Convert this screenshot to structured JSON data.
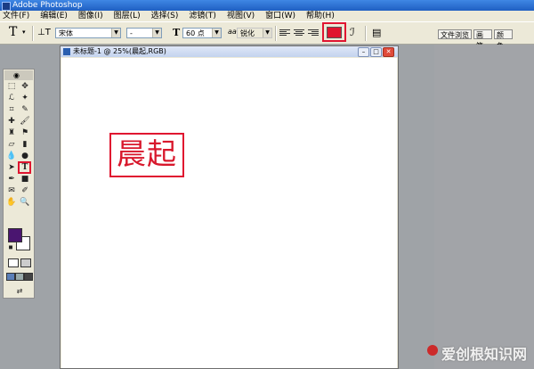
{
  "app": {
    "title": "Adobe Photoshop"
  },
  "menu": [
    "文件(F)",
    "编辑(E)",
    "图像(I)",
    "图层(L)",
    "选择(S)",
    "滤镜(T)",
    "视图(V)",
    "窗口(W)",
    "帮助(H)"
  ],
  "options_bar": {
    "tool_letter": "T",
    "orient_icon": "text-orientation-icon",
    "font_family": "宋体",
    "font_style": "-",
    "size_icon": "T",
    "font_size": "60 点",
    "antialias_prefix": "aa",
    "antialias": "锐化",
    "text_color": "#e0142e"
  },
  "palette_tabs": [
    "文件浏览",
    "画笔",
    "颜色"
  ],
  "document": {
    "title": "未标题-1 @ 25%(晨起,RGB)",
    "text": "晨起",
    "text_color": "#d8182c"
  },
  "toolbox": {
    "foreground_color": "#4a1570",
    "background_color": "#ffffff"
  },
  "watermark": "爱创根知识网"
}
